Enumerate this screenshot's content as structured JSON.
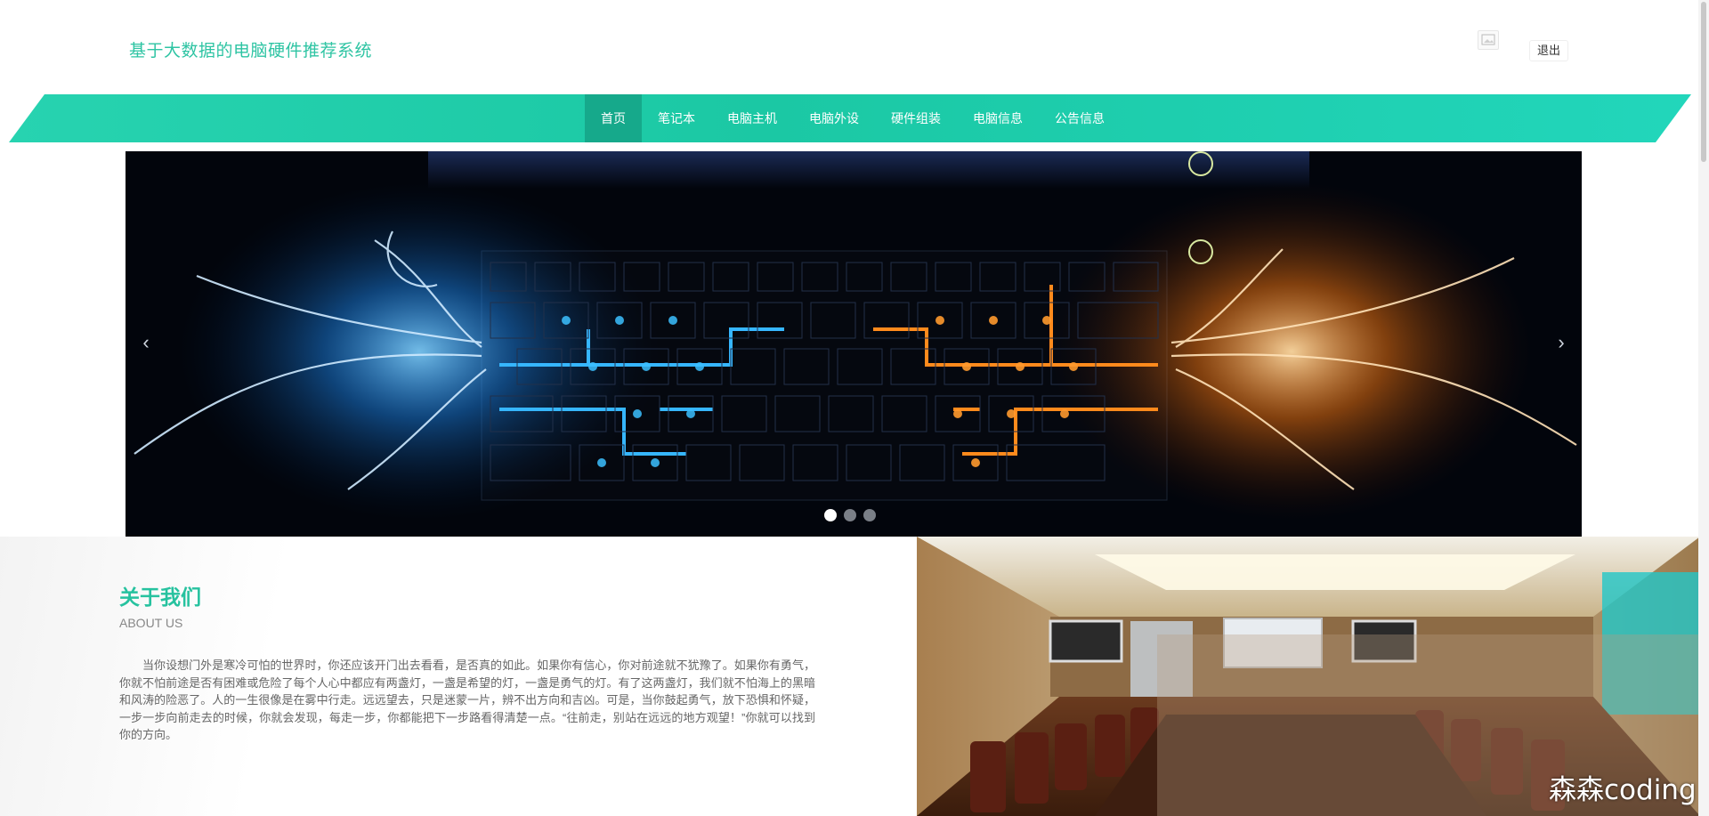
{
  "header": {
    "site_title": "基于大数据的电脑硬件推荐系统",
    "logout_label": "退出"
  },
  "nav": {
    "items": [
      {
        "label": "首页",
        "active": true
      },
      {
        "label": "笔记本"
      },
      {
        "label": "电脑主机"
      },
      {
        "label": "电脑外设"
      },
      {
        "label": "硬件组装"
      },
      {
        "label": "电脑信息"
      },
      {
        "label": "公告信息"
      }
    ]
  },
  "banner": {
    "prev_icon": "‹",
    "next_icon": "›",
    "slide_count": 3,
    "active_slide": 1
  },
  "about": {
    "title": "关于我们",
    "subtitle": "ABOUT US",
    "text": "当你设想门外是寒冷可怕的世界时，你还应该开门出去看看，是否真的如此。如果你有信心，你对前途就不犹豫了。如果你有勇气，你就不怕前途是否有困难或危险了每个人心中都应有两盏灯，一盏是希望的灯，一盏是勇气的灯。有了这两盏灯，我们就不怕海上的黑暗和风涛的险恶了。人的一生很像是在雾中行走。远远望去，只是迷蒙一片，辨不出方向和吉凶。可是，当你鼓起勇气，放下恐惧和怀疑，一步一步向前走去的时候，你就会发现，每走一步，你都能把下一步路看得清楚一点。“往前走，别站在远远的地方观望！”你就可以找到你的方向。"
  },
  "watermark": "森森coding",
  "colors": {
    "accent": "#26c29f",
    "nav_active": "#16a98b",
    "banner_blue": "#2fa8ff",
    "banner_orange": "#ff7a10"
  }
}
